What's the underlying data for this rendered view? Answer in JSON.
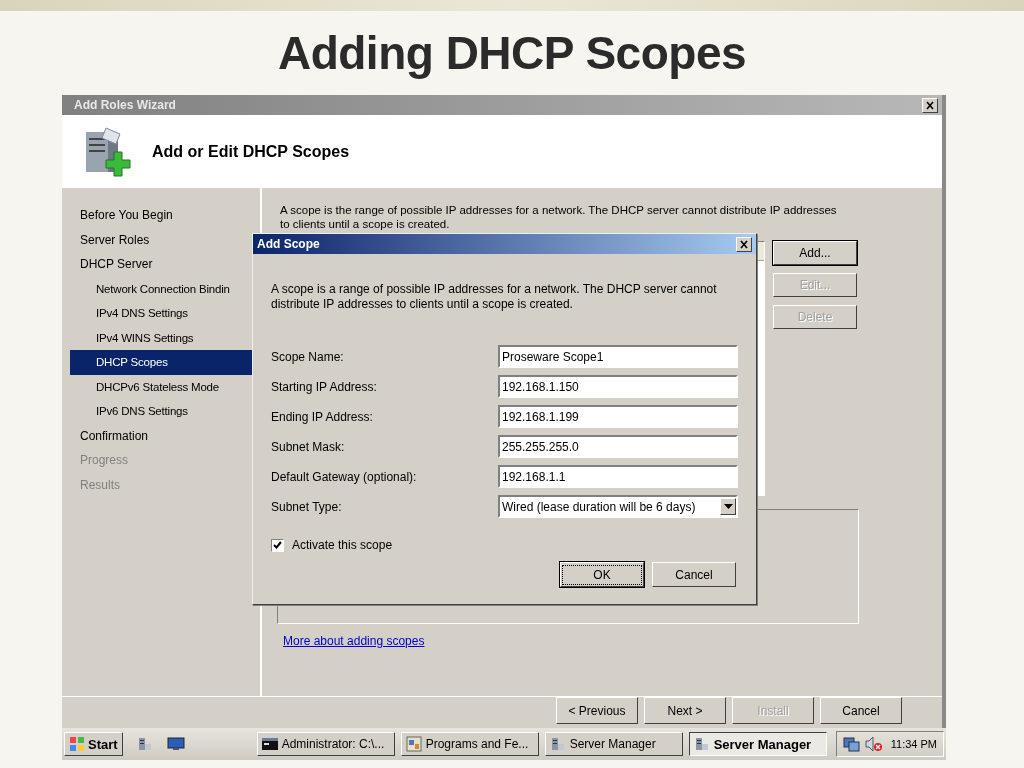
{
  "slide": {
    "title": "Adding DHCP Scopes"
  },
  "wizard": {
    "title": "Add Roles Wizard",
    "heading": "Add or Edit DHCP Scopes",
    "steps": [
      {
        "label": "Before You Begin",
        "selected": false,
        "disabled": false
      },
      {
        "label": "Server Roles",
        "selected": false,
        "disabled": false
      },
      {
        "label": "DHCP Server",
        "selected": false,
        "disabled": false,
        "children": [
          {
            "label": "Network Connection Bindin",
            "selected": false,
            "disabled": false
          },
          {
            "label": "IPv4 DNS Settings",
            "selected": false,
            "disabled": false
          },
          {
            "label": "IPv4 WINS Settings",
            "selected": false,
            "disabled": false
          },
          {
            "label": "DHCP Scopes",
            "selected": true,
            "disabled": false
          },
          {
            "label": "DHCPv6 Stateless Mode",
            "selected": false,
            "disabled": false
          },
          {
            "label": "IPv6 DNS Settings",
            "selected": false,
            "disabled": false
          }
        ]
      },
      {
        "label": "Confirmation",
        "selected": false,
        "disabled": false
      },
      {
        "label": "Progress",
        "selected": false,
        "disabled": true
      },
      {
        "label": "Results",
        "selected": false,
        "disabled": true
      }
    ],
    "description": "A scope is the range of possible IP addresses for a network. The DHCP server cannot distribute IP addresses to clients until a scope is created.",
    "scope_buttons": [
      {
        "label": "Add...",
        "disabled": false
      },
      {
        "label": "Edit...",
        "disabled": true
      },
      {
        "label": "Delete",
        "disabled": true
      }
    ],
    "link": "More about adding scopes",
    "nav_buttons": [
      {
        "label": "< Previous",
        "disabled": false
      },
      {
        "label": "Next >",
        "disabled": false
      },
      {
        "label": "Install",
        "disabled": true
      },
      {
        "label": "Cancel",
        "disabled": false
      }
    ]
  },
  "dialog": {
    "title": "Add Scope",
    "description": "A scope is a range of possible IP addresses for a network. The DHCP server cannot distribute IP addresses to clients until a scope is created.",
    "fields": [
      {
        "label": "Scope Name:",
        "value": "Proseware Scope1",
        "kind": "text"
      },
      {
        "label": "Starting IP Address:",
        "value": "192.168.1.150",
        "kind": "text"
      },
      {
        "label": "Ending IP Address:",
        "value": "192.168.1.199",
        "kind": "text"
      },
      {
        "label": "Subnet Mask:",
        "value": "255.255.255.0",
        "kind": "text"
      },
      {
        "label": "Default Gateway (optional):",
        "value": "192.168.1.1",
        "kind": "text"
      },
      {
        "label": "Subnet Type:",
        "value": "Wired (lease duration will be 6 days)",
        "kind": "select"
      }
    ],
    "activate": {
      "label": "Activate this scope",
      "checked": true
    },
    "buttons": [
      {
        "label": "OK",
        "default": true
      },
      {
        "label": "Cancel",
        "default": false
      }
    ]
  },
  "taskbar": {
    "start": "Start",
    "tasks": [
      {
        "label": "Administrator: C:\\...",
        "kind": "console",
        "selected": false
      },
      {
        "label": "Programs and Fe...",
        "kind": "programs",
        "selected": false
      },
      {
        "label": "Server Manager",
        "kind": "server",
        "selected": false
      },
      {
        "label": "Server Manager",
        "kind": "server",
        "selected": true
      }
    ],
    "clock": "11:34 PM"
  }
}
